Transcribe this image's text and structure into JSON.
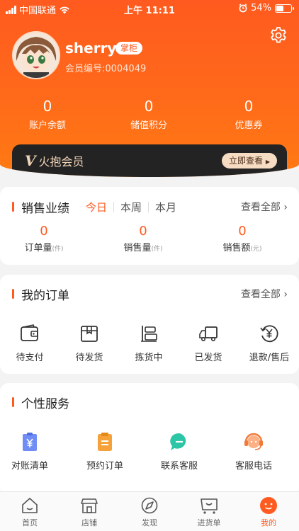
{
  "status_bar": {
    "carrier": "中国联通",
    "time": "上午 11:11",
    "battery": "54%",
    "battery_level": 0.54
  },
  "profile": {
    "name": "sherry",
    "role_badge": "掌柜",
    "member_id": "会员编号:0004049"
  },
  "stats": [
    {
      "value": "0",
      "label": "账户余额"
    },
    {
      "value": "0",
      "label": "储值积分"
    },
    {
      "value": "0",
      "label": "优惠券"
    }
  ],
  "vip": {
    "logo_mark": "V",
    "logo_text": "火抱会员",
    "button": "立即查看"
  },
  "sales": {
    "title": "销售业绩",
    "tabs": [
      "今日",
      "本周",
      "本月"
    ],
    "active_tab": 0,
    "view_all": "查看全部",
    "metrics": [
      {
        "value": "0",
        "label": "订单量",
        "unit": "(件)"
      },
      {
        "value": "0",
        "label": "销售量",
        "unit": "(件)"
      },
      {
        "value": "0",
        "label": "销售额",
        "unit": "(元)"
      }
    ]
  },
  "orders": {
    "title": "我的订单",
    "view_all": "查看全部",
    "items": [
      {
        "label": "待支付",
        "icon": "wallet-icon"
      },
      {
        "label": "待发货",
        "icon": "box-icon"
      },
      {
        "label": "拣货中",
        "icon": "picking-icon"
      },
      {
        "label": "已发货",
        "icon": "truck-icon"
      },
      {
        "label": "退款/售后",
        "icon": "refund-icon"
      }
    ]
  },
  "services": {
    "title": "个性服务",
    "items": [
      {
        "label": "对账清单",
        "icon": "statement-icon"
      },
      {
        "label": "预约订单",
        "icon": "clipboard-icon"
      },
      {
        "label": "联系客服",
        "icon": "chat-icon"
      },
      {
        "label": "客服电话",
        "icon": "headset-icon"
      }
    ]
  },
  "tab_bar": {
    "items": [
      {
        "label": "首页",
        "icon": "home-icon"
      },
      {
        "label": "店铺",
        "icon": "store-icon"
      },
      {
        "label": "发现",
        "icon": "compass-icon"
      },
      {
        "label": "进货单",
        "icon": "cart-icon"
      },
      {
        "label": "我的",
        "icon": "profile-icon"
      }
    ],
    "active": 4
  },
  "colors": {
    "accent": "#ff5a1f",
    "header_gradient_end": "#ff7a12",
    "vip_bar": "#232323",
    "vip_gold": "#f2d5b8"
  }
}
